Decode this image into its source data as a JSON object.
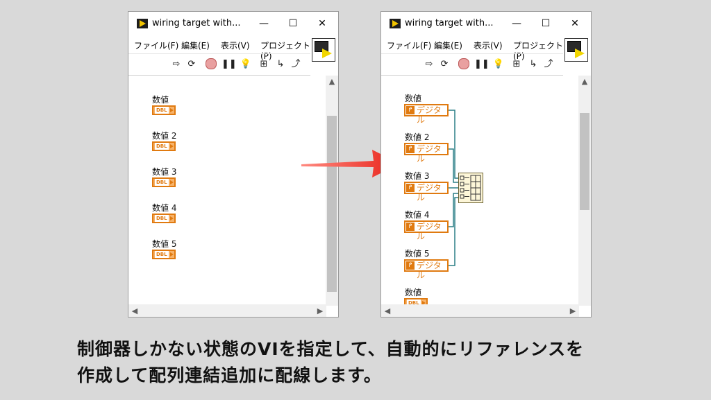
{
  "left_window": {
    "title": "wiring target with...",
    "menu": [
      "ファイル(F)",
      "編集(E)",
      "表示(V)",
      "プロジェクト(P)"
    ],
    "controls": [
      {
        "label": "数値",
        "tag": "DBL"
      },
      {
        "label": "数値 2",
        "tag": "DBL"
      },
      {
        "label": "数値 3",
        "tag": "DBL"
      },
      {
        "label": "数値 4",
        "tag": "DBL"
      },
      {
        "label": "数値 5",
        "tag": "DBL"
      }
    ]
  },
  "right_window": {
    "title": "wiring target with...",
    "menu": [
      "ファイル(F)",
      "編集(E)",
      "表示(V)",
      "プロジェクト(P)"
    ],
    "refs": [
      {
        "label": "数値",
        "tag": "デジタル"
      },
      {
        "label": "数値 2",
        "tag": "デジタル"
      },
      {
        "label": "数値 3",
        "tag": "デジタル"
      },
      {
        "label": "数値 4",
        "tag": "デジタル"
      },
      {
        "label": "数値 5",
        "tag": "デジタル"
      }
    ],
    "extra_control": {
      "label": "数値",
      "tag": "DBL"
    }
  },
  "window_buttons": {
    "minimize": "—",
    "maximize": "☐",
    "close": "✕"
  },
  "caption": {
    "line1": "制御器しかない状態のVIを指定して、自動的にリファレンスを",
    "line2": "作成して配列連結追加に配線します。"
  },
  "colors": {
    "arrow": "#e8231a",
    "wire": "#2a7f86",
    "control": "#e07a10"
  }
}
